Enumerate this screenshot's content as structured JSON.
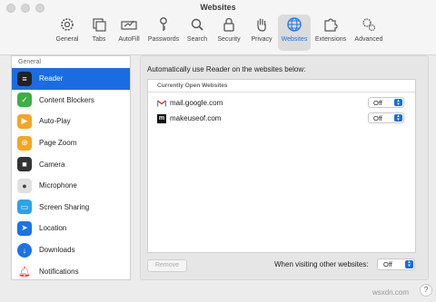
{
  "window": {
    "title": "Websites"
  },
  "toolbar": [
    {
      "label": "General",
      "icon": "gear-icon"
    },
    {
      "label": "Tabs",
      "icon": "tabs-icon"
    },
    {
      "label": "AutoFill",
      "icon": "autofill-icon"
    },
    {
      "label": "Passwords",
      "icon": "key-icon"
    },
    {
      "label": "Search",
      "icon": "magnifier-icon"
    },
    {
      "label": "Security",
      "icon": "lock-icon"
    },
    {
      "label": "Privacy",
      "icon": "hand-icon"
    },
    {
      "label": "Websites",
      "icon": "globe-icon",
      "active": true
    },
    {
      "label": "Extensions",
      "icon": "puzzle-icon"
    },
    {
      "label": "Advanced",
      "icon": "gears-icon"
    }
  ],
  "sidebar": {
    "section": "General",
    "items": [
      {
        "label": "Reader",
        "icon": "reader-icon",
        "color": "#222222",
        "selected": true
      },
      {
        "label": "Content Blockers",
        "icon": "content-blockers-icon",
        "color": "#3cb043"
      },
      {
        "label": "Auto-Play",
        "icon": "autoplay-icon",
        "color": "#f5a623"
      },
      {
        "label": "Page Zoom",
        "icon": "page-zoom-icon",
        "color": "#f5a623"
      },
      {
        "label": "Camera",
        "icon": "camera-icon",
        "color": "#333333"
      },
      {
        "label": "Microphone",
        "icon": "microphone-icon",
        "color": "#666666"
      },
      {
        "label": "Screen Sharing",
        "icon": "screen-sharing-icon",
        "color": "#2aa3e8"
      },
      {
        "label": "Location",
        "icon": "location-icon",
        "color": "#1a73e8"
      },
      {
        "label": "Downloads",
        "icon": "downloads-icon",
        "color": "#1a73e8"
      },
      {
        "label": "Notifications",
        "icon": "notifications-icon",
        "color": "#e53935"
      }
    ]
  },
  "main": {
    "description": "Automatically use Reader on the websites below:",
    "table_header": "Currently Open Websites",
    "sites": [
      {
        "name": "mail.google.com",
        "icon": "gmail-icon",
        "value": "Off"
      },
      {
        "name": "makeuseof.com",
        "icon": "makeuseof-icon",
        "value": "Off"
      }
    ],
    "remove_label": "Remove",
    "other_label": "When visiting other websites:",
    "other_value": "Off"
  },
  "help": "?",
  "watermark": "wsxdn.com",
  "accent": "#1a6de1"
}
